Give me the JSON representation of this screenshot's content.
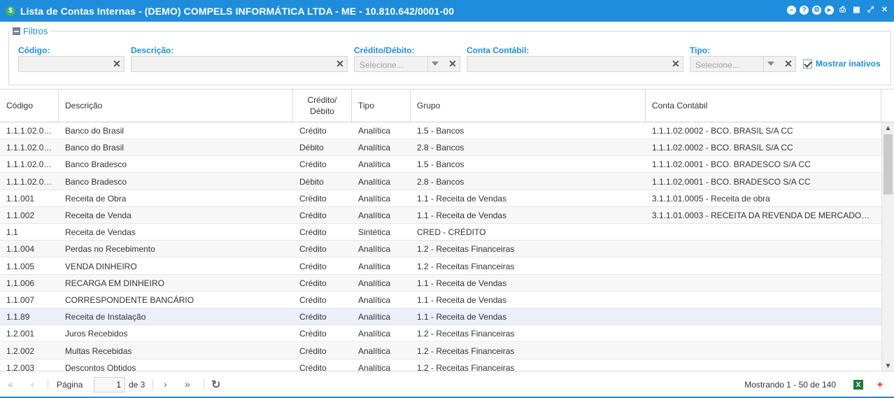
{
  "window": {
    "title": "Lista de Contas Internas - (DEMO) COMPELS INFORMÁTICA LTDA - ME - 10.810.642/0001-00",
    "app_icon": "$",
    "colors": {
      "accent": "#1f8ddb",
      "selected_row": "#eaf0f6"
    }
  },
  "toolbar_icons": [
    "minimize-circle-icon",
    "help-icon",
    "settings-icon",
    "play-icon",
    "print-icon",
    "calendar-icon",
    "expand-icon",
    "close-icon"
  ],
  "filters": {
    "title": "Filtros",
    "codigo_label": "Código:",
    "descricao_label": "Descrição:",
    "credito_debito_label": "Crédito/Débito:",
    "credito_debito_placeholder": "Selecione...",
    "conta_contabil_label": "Conta Contábil:",
    "tipo_label": "Tipo:",
    "tipo_placeholder": "Selecione...",
    "mostrar_inativos_label": "Mostrar inativos",
    "mostrar_inativos_checked": true
  },
  "grid": {
    "columns": [
      "Código",
      "Descrição",
      "Crédito/",
      "Débito",
      "Tipo",
      "Grupo",
      "Conta Contábil"
    ],
    "rows": [
      {
        "codigo": "1.1.1.02.0…",
        "descricao": "Banco do Brasil",
        "cd": "Crédito",
        "tipo": "Analítica",
        "grupo": "1.5 - Bancos",
        "conta": "1.1.1.02.0002 - BCO. BRASIL S/A CC"
      },
      {
        "codigo": "1.1.1.02.0…",
        "descricao": "Banco do Brasil",
        "cd": "Débito",
        "tipo": "Analítica",
        "grupo": "2.8 - Bancos",
        "conta": "1.1.1.02.0002 - BCO. BRASIL S/A CC"
      },
      {
        "codigo": "1.1.1.02.0…",
        "descricao": "Banco Bradesco",
        "cd": "Crédito",
        "tipo": "Analítica",
        "grupo": "1.5 - Bancos",
        "conta": "1.1.1.02.0001 - BCO. BRADESCO S/A CC"
      },
      {
        "codigo": "1.1.1.02.0…",
        "descricao": "Banco Bradesco",
        "cd": "Débito",
        "tipo": "Analítica",
        "grupo": "2.8 - Bancos",
        "conta": "1.1.1.02.0001 - BCO. BRADESCO S/A CC"
      },
      {
        "codigo": "1.1.001",
        "descricao": "Receita de Obra",
        "cd": "Crédito",
        "tipo": "Analítica",
        "grupo": "1.1 - Receita de Vendas",
        "conta": "3.1.1.01.0005 - Receita de obra"
      },
      {
        "codigo": "1.1.002",
        "descricao": "Receita de Venda",
        "cd": "Crédito",
        "tipo": "Analítica",
        "grupo": "1.1 - Receita de Vendas",
        "conta": "3.1.1.01.0003 - RECEITA DA REVENDA DE MERCADO…"
      },
      {
        "codigo": "1.1",
        "descricao": "Receita de Vendas",
        "cd": "Crédito",
        "tipo": "Sintética",
        "grupo": "CRED - CRÉDITO",
        "conta": ""
      },
      {
        "codigo": "1.1.004",
        "descricao": "Perdas no Recebimento",
        "cd": "Crédito",
        "tipo": "Analítica",
        "grupo": "1.2 - Receitas Financeiras",
        "conta": ""
      },
      {
        "codigo": "1.1.005",
        "descricao": "VENDA DINHEIRO",
        "cd": "Crédito",
        "tipo": "Analítica",
        "grupo": "1.2 - Receitas Financeiras",
        "conta": ""
      },
      {
        "codigo": "1.1.006",
        "descricao": "RECARGA EM DINHEIRO",
        "cd": "Crédito",
        "tipo": "Analítica",
        "grupo": "1.1 - Receita de Vendas",
        "conta": ""
      },
      {
        "codigo": "1.1.007",
        "descricao": "CORRESPONDENTE BANCÁRIO",
        "cd": "Crédito",
        "tipo": "Analítica",
        "grupo": "1.1 - Receita de Vendas",
        "conta": ""
      },
      {
        "codigo": "1.1.89",
        "descricao": "Receita de Instalação",
        "cd": "Crédito",
        "tipo": "Analítica",
        "grupo": "1.1 - Receita de Vendas",
        "conta": "",
        "selected": true
      },
      {
        "codigo": "1.2.001",
        "descricao": "Juros Recebidos",
        "cd": "Crédito",
        "tipo": "Analítica",
        "grupo": "1.2 - Receitas Financeiras",
        "conta": ""
      },
      {
        "codigo": "1.2.002",
        "descricao": "Multas Recebidas",
        "cd": "Crédito",
        "tipo": "Analítica",
        "grupo": "1.2 - Receitas Financeiras",
        "conta": ""
      },
      {
        "codigo": "1.2.003",
        "descricao": "Descontos Obtidos",
        "cd": "Crédito",
        "tipo": "Analítica",
        "grupo": "1.2 - Receitas Financeiras",
        "conta": ""
      }
    ]
  },
  "pager": {
    "page_label": "Página",
    "page_value": "1",
    "of_label": "de 3",
    "info": "Mostrando 1 - 50 de 140"
  }
}
